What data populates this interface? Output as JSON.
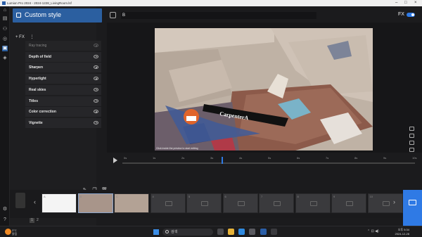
{
  "window": {
    "title": "Lumion Pro 2024 - 2024-1228_LivingRoom.lsf"
  },
  "panel": {
    "style_title": "Custom style",
    "add_fx": "+ FX",
    "more": "⋮",
    "effects": [
      {
        "label": "Ray tracing",
        "enabled": false
      },
      {
        "label": "Depth of field",
        "enabled": true
      },
      {
        "label": "Sharpen",
        "enabled": true
      },
      {
        "label": "Hyperlight",
        "enabled": true
      },
      {
        "label": "Real skies",
        "enabled": true
      },
      {
        "label": "Titles",
        "enabled": true
      },
      {
        "label": "Color correction",
        "enabled": true
      },
      {
        "label": "Vignette",
        "enabled": true
      }
    ]
  },
  "topbar": {
    "clip_name": "B",
    "fx_label": "FX",
    "fx_toggle": true
  },
  "viewport": {
    "title_text": "CarpenterA",
    "watermark": "Click inside the preview to start editing"
  },
  "timeline": {
    "labels": [
      "0s",
      "1s",
      "2s",
      "3s",
      "4s",
      "5s",
      "6s",
      "7s",
      "8s",
      "9s",
      "10s"
    ],
    "playhead_seconds": 3.4
  },
  "filmstrip": {
    "clips": [
      {
        "num": "A",
        "thumb": "white"
      },
      {
        "num": "B",
        "thumb": "room",
        "selected": true
      },
      {
        "num": "C",
        "thumb": "room2"
      },
      {
        "num": "4",
        "thumb": "empty"
      },
      {
        "num": "5",
        "thumb": "empty"
      },
      {
        "num": "6",
        "thumb": "empty"
      },
      {
        "num": "7",
        "thumb": "empty"
      },
      {
        "num": "8",
        "thumb": "empty"
      },
      {
        "num": "9",
        "thumb": "empty"
      },
      {
        "num": "10",
        "thumb": "empty"
      }
    ],
    "pages": [
      "1",
      "2"
    ]
  },
  "taskbar": {
    "weather_temp": "3°C",
    "weather_desc": "맑음",
    "search_placeholder": "검색",
    "time": "오후 5:34",
    "date": "2024-12-28"
  },
  "colors": {
    "accent": "#2f7ae5",
    "panel_header": "#2b5fa0"
  }
}
